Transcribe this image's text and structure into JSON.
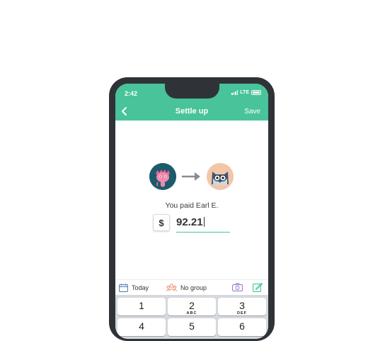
{
  "status_bar": {
    "time": "2:42",
    "carrier": "LTE"
  },
  "header": {
    "title": "Settle up",
    "save_label": "Save"
  },
  "payment": {
    "message": "You paid Earl E.",
    "currency_symbol": "$",
    "amount": "92.21"
  },
  "toolbar": {
    "date_label": "Today",
    "group_label": "No group"
  },
  "keypad": {
    "keys": [
      {
        "num": "1",
        "letters": ""
      },
      {
        "num": "2",
        "letters": "ABC"
      },
      {
        "num": "3",
        "letters": "DEF"
      },
      {
        "num": "4",
        "letters": ""
      },
      {
        "num": "5",
        "letters": ""
      },
      {
        "num": "6",
        "letters": ""
      }
    ]
  },
  "colors": {
    "accent": "#48c39a",
    "phone_frame": "#2f3337",
    "keypad_bg": "#d5d8dd"
  }
}
